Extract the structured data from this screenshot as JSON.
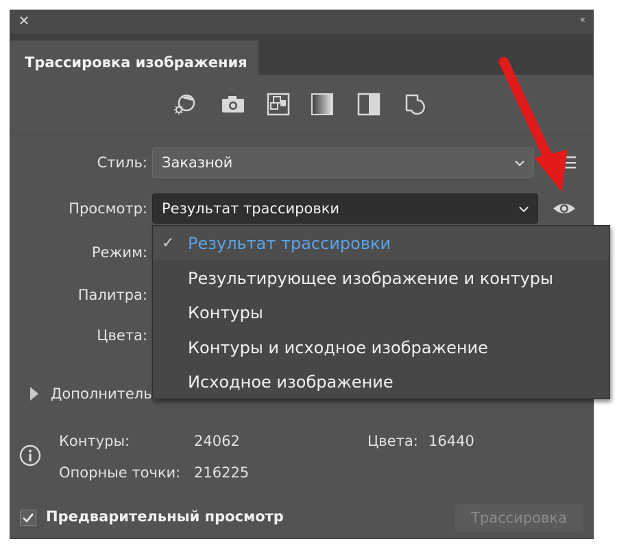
{
  "panel": {
    "close_glyph": "✕",
    "collapse_glyph": "‹‹",
    "tab_title": "Трассировка изображения"
  },
  "presets": {
    "icons": [
      "auto-color-icon",
      "camera-icon",
      "grid-icon",
      "gradient-icon",
      "half-contrast-icon",
      "outline-shape-icon"
    ]
  },
  "style": {
    "label": "Стиль:",
    "value": "Заказной"
  },
  "view": {
    "label": "Просмотр:",
    "value": "Результат трассировки"
  },
  "mode": {
    "label": "Режим:"
  },
  "palette": {
    "label": "Палитра:"
  },
  "colors": {
    "label": "Цвета:"
  },
  "dropdown": {
    "check_glyph": "✓",
    "items": [
      "Результат трассировки",
      "Результирующее изображение и контуры",
      "Контуры",
      "Контуры и исходное изображение",
      "Исходное изображение"
    ],
    "selected_index": 0
  },
  "advanced": {
    "label": "Дополнительно"
  },
  "stats": {
    "paths_label": "Контуры:",
    "paths_value": "24062",
    "anchors_label": "Опорные точки:",
    "anchors_value": "216225",
    "colors_label": "Цвета:",
    "colors_value": "16440"
  },
  "footer": {
    "preview_label": "Предварительный просмотр",
    "preview_checked": true,
    "trace_button": "Трассировка"
  },
  "colors_theme": {
    "panel_bg": "#535353",
    "selected_item": "#5aa3e8",
    "arrow": "#e41b1b"
  }
}
